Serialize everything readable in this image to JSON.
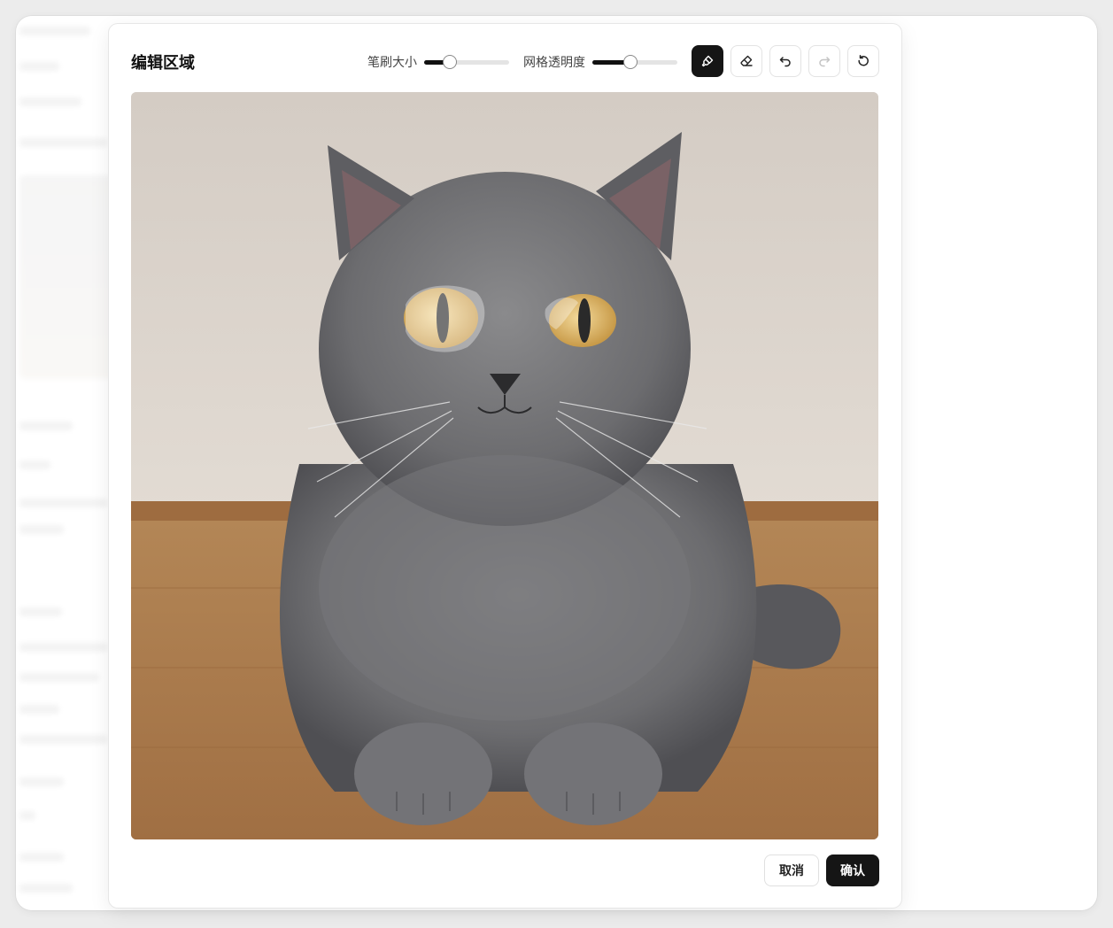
{
  "modal": {
    "title": "编辑区域",
    "brush_size_label": "笔刷大小",
    "brush_size_value": 0.3,
    "grid_opacity_label": "网格透明度",
    "grid_opacity_value": 0.45,
    "tools": [
      {
        "name": "brush-icon",
        "active": true
      },
      {
        "name": "eraser-icon",
        "active": false
      },
      {
        "name": "undo-icon",
        "active": false
      },
      {
        "name": "redo-icon",
        "active": false,
        "disabled": true
      },
      {
        "name": "reset-icon",
        "active": false
      }
    ],
    "image": {
      "subject": "cat-photo",
      "mask_regions": 1
    },
    "cancel_label": "取消",
    "confirm_label": "确认"
  },
  "colors": {
    "primary": "#151515",
    "border": "#e3e3e3",
    "track": "#e4e4e4"
  }
}
